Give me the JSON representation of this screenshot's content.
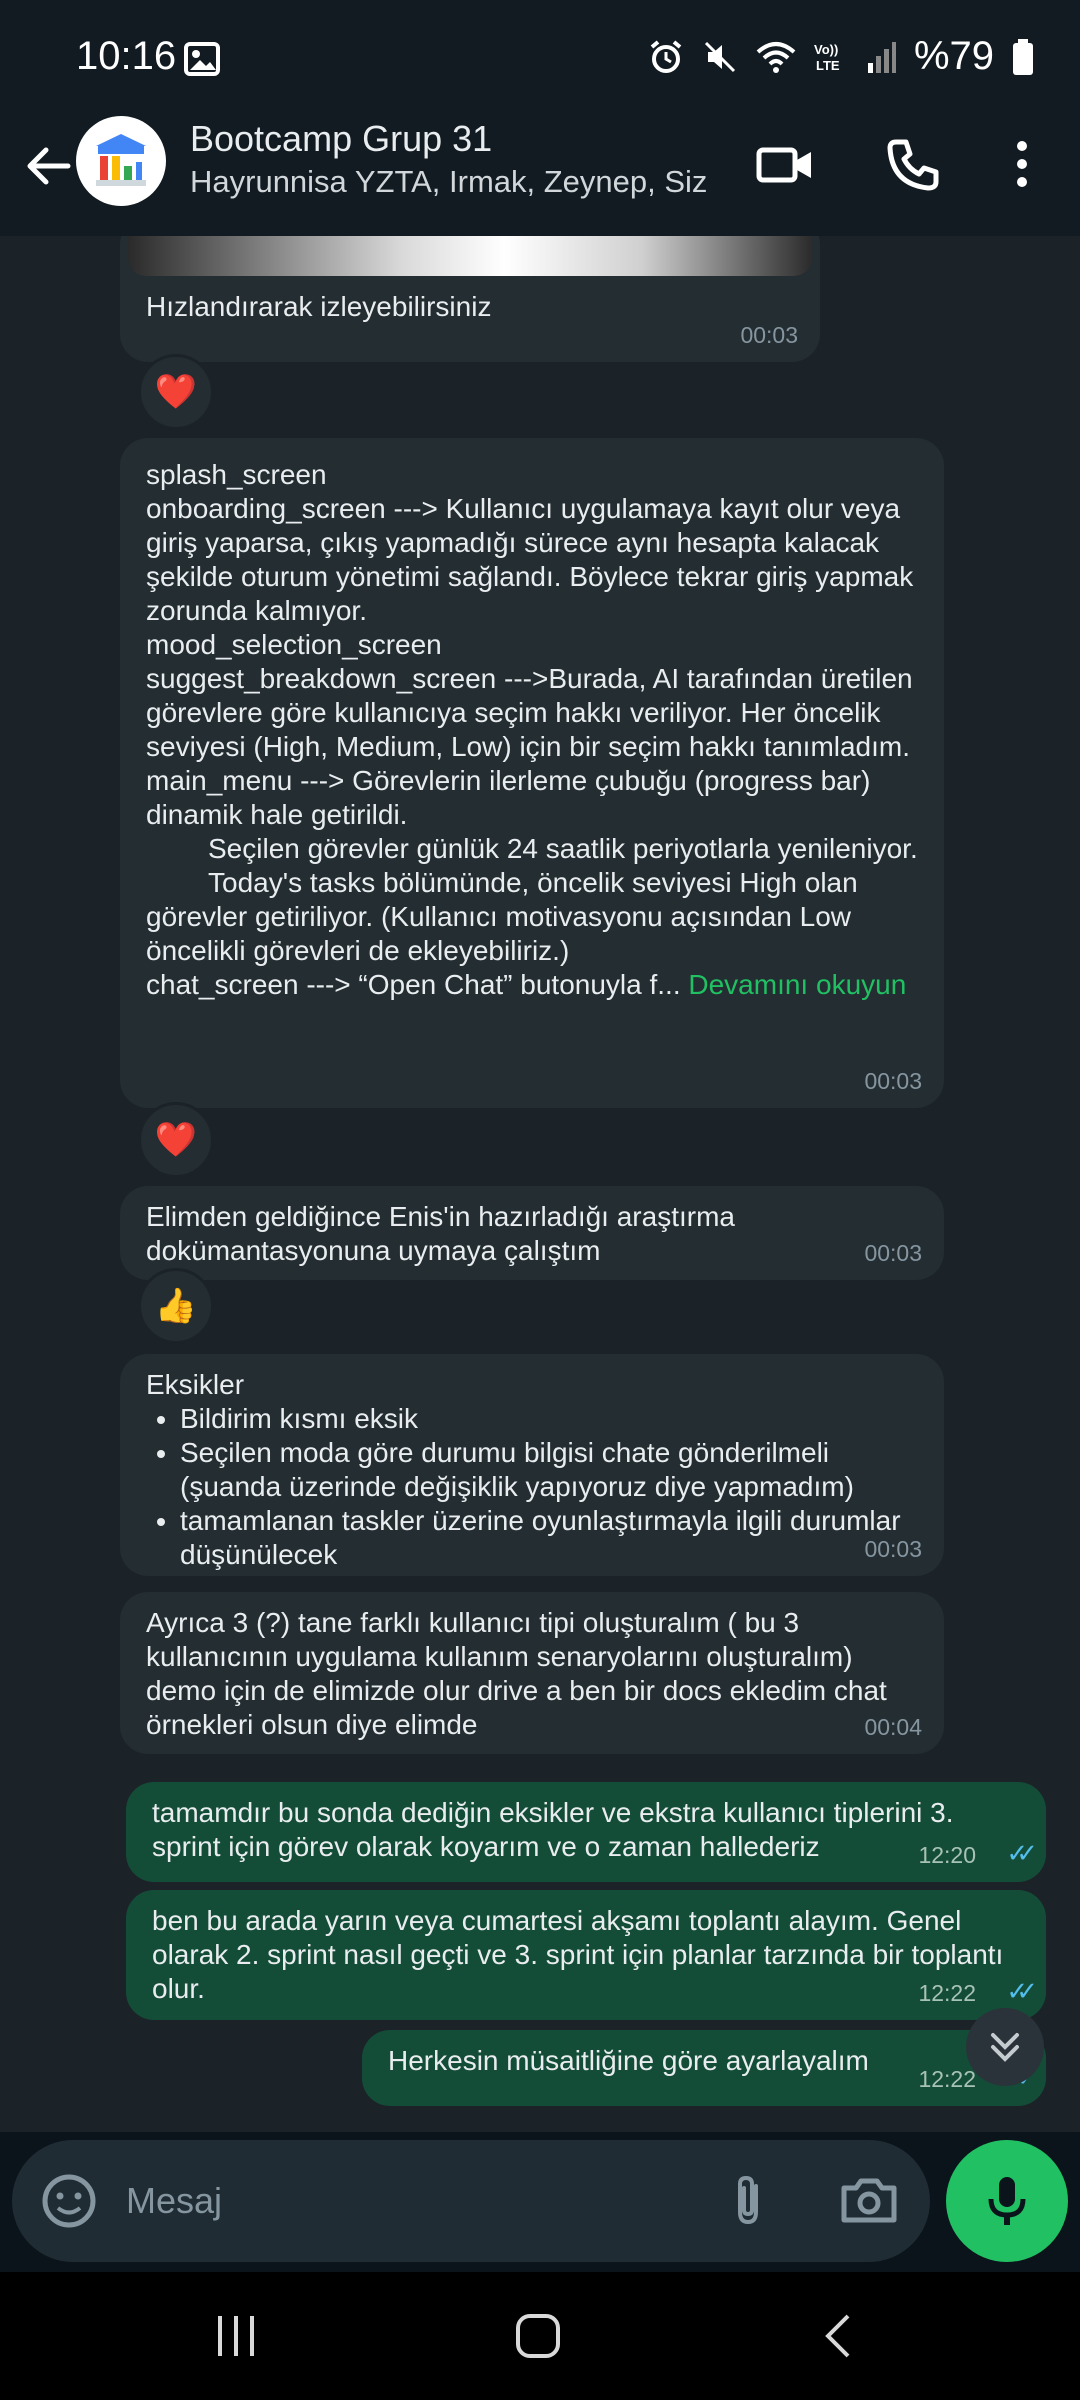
{
  "status_bar": {
    "time": "10:16",
    "battery": "%79"
  },
  "header": {
    "title": "Bootcamp Grup 31",
    "subtitle": "Hayrunnisa YZTA, Irmak, Zeynep, Siz"
  },
  "messages": [
    {
      "id": "m1",
      "text": "Hızlandırarak izleyebilirsiniz",
      "time": "00:03",
      "reaction": "❤️"
    },
    {
      "id": "m2",
      "lines": [
        "splash_screen",
        "onboarding_screen ---> Kullanıcı uygulamaya kayıt olur veya giriş yaparsa, çıkış yapmadığı sürece aynı hesapta kalacak şekilde oturum yönetimi sağlandı. Böylece tekrar giriş yapmak zorunda kalmıyor.",
        "mood_selection_screen",
        "suggest_breakdown_screen --->Burada, AI tarafından üretilen görevlere göre kullanıcıya seçim hakkı veriliyor. Her öncelik seviyesi (High, Medium, Low) için bir seçim hakkı tanımladım.",
        "main_menu ---> Görevlerin ilerleme çubuğu (progress bar) dinamik hale getirildi.",
        "Seçilen görevler günlük 24 saatlik periyotlarla yenileniyor.",
        "Today's tasks bölümünde, öncelik seviyesi High olan görevler getiriliyor. (Kullanıcı motivasyonu açısından Low öncelikli görevleri de ekleyebiliriz.)",
        "chat_screen ---> “Open Chat” butonuyla f..."
      ],
      "read_more": "Devamını okuyun",
      "time": "00:03",
      "reaction": "❤️"
    },
    {
      "id": "m3",
      "text": "Elimden geldiğince Enis'in hazırladığı araştırma dokümantasyonuna uymaya çalıştım",
      "time": "00:03",
      "reaction": "👍"
    },
    {
      "id": "m4",
      "title": "Eksikler",
      "bullets": [
        "Bildirim kısmı eksik",
        "Seçilen moda göre durumu bilgisi chate gönderilmeli (şuanda üzerinde değişiklik yapıyoruz diye yapmadım)",
        "tamamlanan taskler üzerine oyunlaştırmayla ilgili durumlar düşünülecek"
      ],
      "time": "00:03"
    },
    {
      "id": "m5",
      "text": "Ayrıca 3 (?) tane farklı kullanıcı tipi oluşturalım ( bu 3 kullanıcının uygulama kullanım senaryolarını oluşturalım) demo için de elimizde olur drive a ben bir docs ekledim chat örnekleri olsun diye elimde",
      "time": "00:04"
    },
    {
      "id": "m6",
      "text": "tamamdır bu sonda dediğin eksikler ve ekstra kullanıcı tiplerini 3. sprint için görev olarak koyarım ve o zaman hallederiz",
      "time": "12:20",
      "outgoing": true
    },
    {
      "id": "m7",
      "text": "ben bu arada yarın veya cumartesi akşamı toplantı alayım. Genel olarak 2. sprint nasıl geçti ve 3. sprint için planlar tarzında bir toplantı olur.",
      "time": "12:22",
      "outgoing": true
    },
    {
      "id": "m8",
      "text": "Herkesin müsaitliğine göre ayarlayalım",
      "time": "12:22",
      "outgoing": true
    }
  ],
  "input": {
    "placeholder": "Mesaj"
  },
  "colors": {
    "accent": "#21c063",
    "outgoing_bubble": "#144d37",
    "incoming_bubble": "#232d32",
    "read_ticks": "#53bdeb"
  }
}
